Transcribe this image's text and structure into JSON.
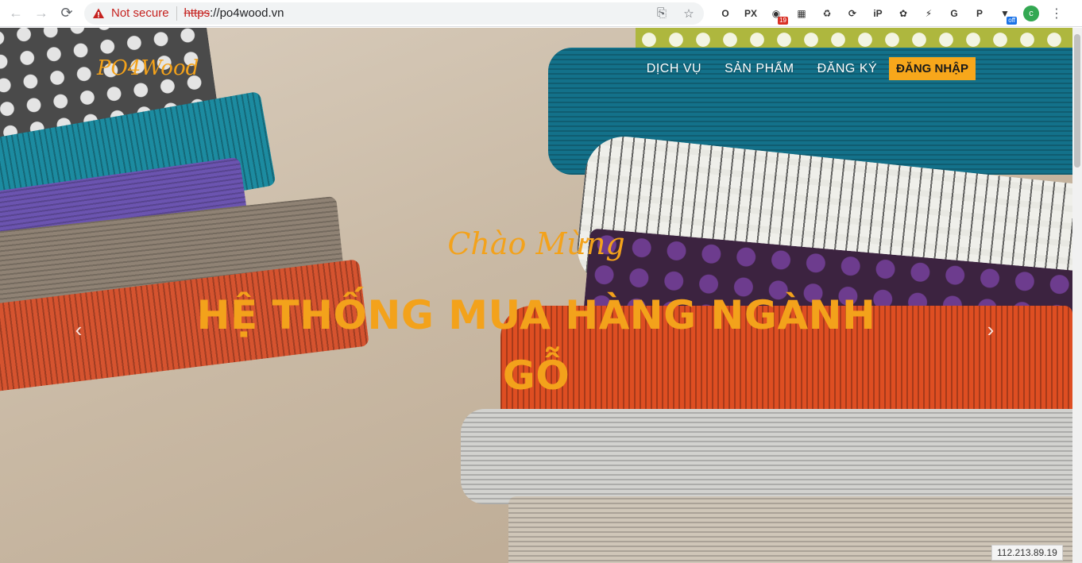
{
  "browser": {
    "security_label": "Not secure",
    "url_scheme": "https",
    "url_rest": "://po4wood.vn",
    "extensions": [
      {
        "name": "o-icon",
        "glyph": "O"
      },
      {
        "name": "px-icon",
        "glyph": "PX"
      },
      {
        "name": "globe-icon",
        "glyph": "◉",
        "badge": "19"
      },
      {
        "name": "bar-chart-icon",
        "glyph": "▦"
      },
      {
        "name": "recycle-icon",
        "glyph": "♻"
      },
      {
        "name": "sync-icon",
        "glyph": "⟳"
      },
      {
        "name": "ip-icon",
        "glyph": "iP"
      },
      {
        "name": "evernote-icon",
        "glyph": "✿"
      },
      {
        "name": "lightning-icon",
        "glyph": "⚡"
      },
      {
        "name": "translate-icon",
        "glyph": "G"
      },
      {
        "name": "pinterest-icon",
        "glyph": "P"
      },
      {
        "name": "funnel-icon",
        "glyph": "▼",
        "badge": "off"
      }
    ],
    "avatar_letter": "c",
    "colors": {
      "warning": "#c5221f",
      "avatar": "#33a852"
    }
  },
  "site": {
    "brand": "PO4Wood",
    "nav": [
      {
        "label": "DỊCH VỤ"
      },
      {
        "label": "SẢN PHẨM"
      },
      {
        "label": "ĐĂNG KÝ"
      }
    ],
    "login_label": "ĐĂNG NHẬP",
    "hero": {
      "welcome": "Chào Mừng",
      "headline": "HỆ THỐNG MUA HÀNG NGÀNH GỖ"
    },
    "colors": {
      "accent": "#f3a21b",
      "login_bg": "#f7a71b"
    }
  },
  "status_bar": {
    "ip": "112.213.89.19"
  }
}
